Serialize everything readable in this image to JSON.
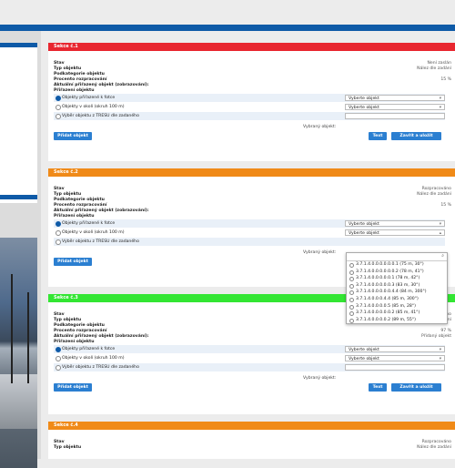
{
  "sections": [
    {
      "title": "Sekce č.1",
      "color": "#e8262f",
      "stav": "Není zaslán",
      "typ": "Nález dle zadání",
      "kategorie": "",
      "procento": "15 %",
      "objekt_value": ""
    },
    {
      "title": "Sekce č.2",
      "color": "#f08a18",
      "stav": "Rozpracováno",
      "typ": "Nález dle zadání",
      "kategorie": "",
      "procento": "15 %",
      "objekt_value": ""
    },
    {
      "title": "Sekce č.3",
      "color": "#33e633",
      "stav": "Rozpracováno",
      "typ": "Nález dle zadání",
      "kategorie": "",
      "procento": "97 %",
      "objekt_value": "Přidaný objekt"
    },
    {
      "title": "Sekce č.4",
      "color": "#f08a18",
      "stav": "Rozpracováno",
      "typ": "Nález dle zadání",
      "kategorie": "",
      "procento": "",
      "objekt_value": ""
    }
  ],
  "labels": {
    "stav": "Stav",
    "typ": "Typ objektu",
    "kategorie": "Podkategorie objektu",
    "procento": "Procento rozpracování",
    "aktualni": "Aktuální přiřazený objekt (zobrazování):",
    "prirazeni": "Přiřazení objektu",
    "opt1": "Objekty přiřazené k fotce",
    "opt2": "Objekty v okolí (okruh 100 m)",
    "opt3": "Výběr objektu z TRESU dle zadaného",
    "select_placeholder": "Vyberte objekt",
    "add_button": "Přidat objekt",
    "vybrany": "Vybraný objekt:",
    "save_button": "Text",
    "save_close_button": "Zavřít a uložit"
  },
  "dropdown": {
    "items": [
      "3.7.1.4.0.0.0.0.0.0.1 (75 m, 30°)",
      "3.7.1.4.0.0.0.0.0.0.2 (78 m, 41°)",
      "3.7.1.4.0.0.0.0.0.1 (78 m, 42°)",
      "3.7.1.4.0.0.0.0.0.3 (83 m, 30°)",
      "3.7.1.4.0.0.0.0.0.4.4 (84 m, 300°)",
      "3.7.1.4.0.0.0.4.4 (85 m, 300°)",
      "3.7.1.4.0.0.0.0.5 (85 m, 28°)",
      "3.7.1.4.0.0.0.0.0.2 (85 m, 41°)",
      "3.7.1.4.0.0.0.0.2 (89 m, 55°)"
    ]
  }
}
